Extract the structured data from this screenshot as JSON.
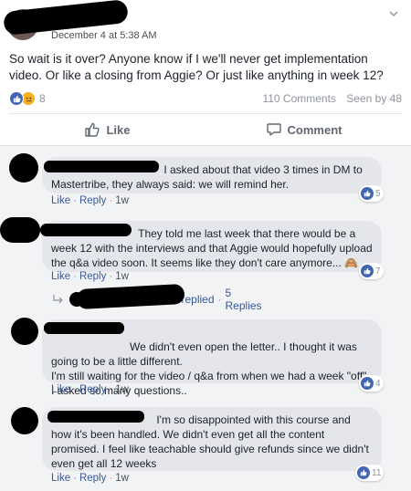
{
  "post": {
    "date": "December 4 at 5:38 AM",
    "text": "So wait is it over? Anyone know if I we'll never get implementation video. Or like a closing from Aggie? Or just like anything in week 12?",
    "reaction_count": "8",
    "comments_count": "110 Comments",
    "seen_by": "Seen by 48",
    "like_label": "Like",
    "comment_label": "Comment"
  },
  "comments": [
    {
      "text": "I asked about that video 3 times in DM to Mastertribe, they always said: we will remind her.",
      "like": "Like",
      "reply": "Reply",
      "time": "1w",
      "likes": "5"
    },
    {
      "text": "They told me last week that there would be a week 12 with the interviews and that Aggie would hopefully upload the q&a video soon. It seems like they don't care anymore... 🙈",
      "like": "Like",
      "reply": "Reply",
      "time": "1w",
      "likes": "7"
    },
    {
      "text": "We didn't even open the letter.. I thought it was going to be a little different.\nI'm still waiting for the video / q&a from when we had a week \"off\" I asked so many questions..",
      "like": "Like",
      "reply": "Reply",
      "time": "1w",
      "likes": "4"
    },
    {
      "text": "I'm so disappointed with this course and how it's been handled. We didn't even get all the content promised. I feel like teachable should give refunds since we didn't even get all 12 weeks",
      "like": "Like",
      "reply": "Reply",
      "time": "1w",
      "likes": "11"
    }
  ],
  "replies_summary": {
    "label": "replied",
    "count": "5 Replies"
  },
  "colors": {
    "link": "#385898",
    "like_blue": "#4267b2",
    "bubble": "#e4e6eb",
    "comment_bg": "#f2f3f5"
  },
  "icons": [
    "chevron-down-icon",
    "like-reaction-icon",
    "sad-reaction-icon",
    "thumbs-up-icon",
    "comment-icon",
    "reply-arrow-icon"
  ]
}
